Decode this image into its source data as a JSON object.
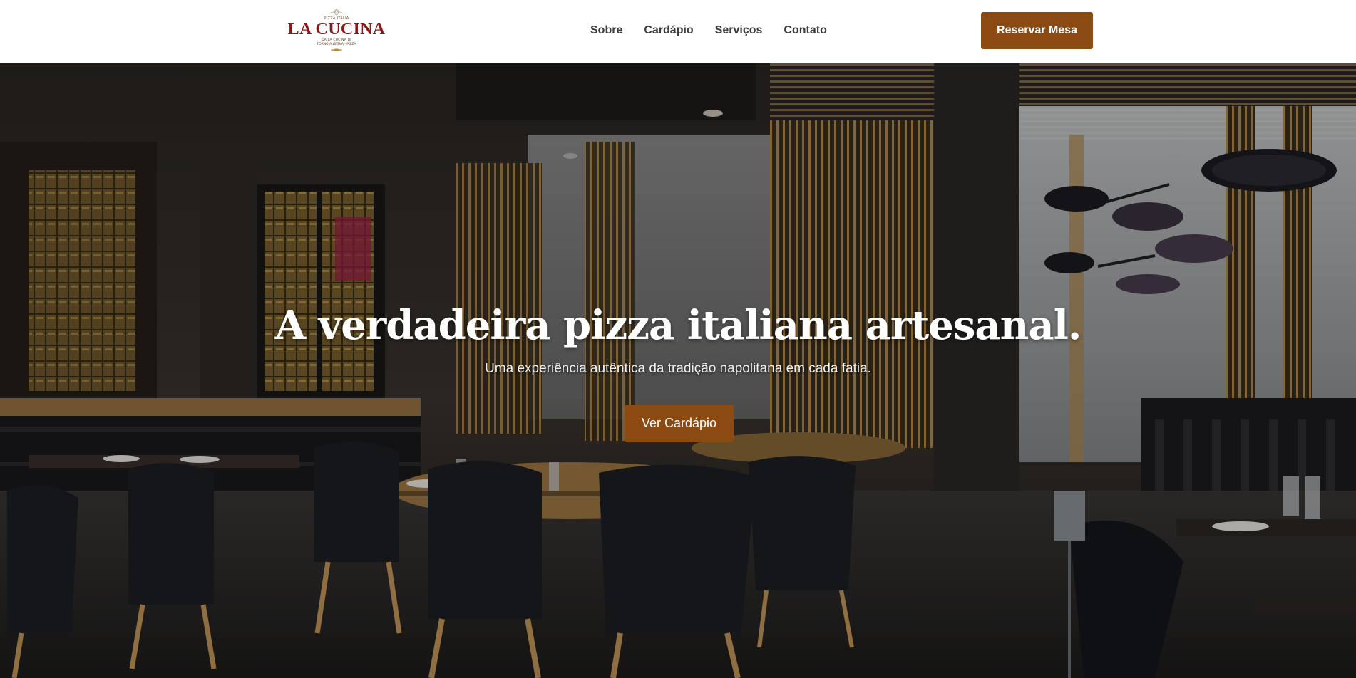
{
  "header": {
    "logo": {
      "name": "LA CUCINA",
      "top_line": "PIZZA ITALIA",
      "tagline": "DA LA CUCINA DI",
      "sub": "FORNO A LEGNA · PIZZA"
    },
    "nav": [
      {
        "label": "Sobre"
      },
      {
        "label": "Cardápio"
      },
      {
        "label": "Serviços"
      },
      {
        "label": "Contato"
      }
    ],
    "reserve_label": "Reservar Mesa"
  },
  "hero": {
    "title": "A verdadeira pizza italiana artesanal.",
    "subtitle": "Uma experiência autêntica da tradição napolitana em cada fatia.",
    "cta_label": "Ver Cardápio"
  },
  "colors": {
    "accent": "#8a4a12",
    "logo_red": "#8a1a18",
    "nav_text": "#3d3d3d"
  }
}
